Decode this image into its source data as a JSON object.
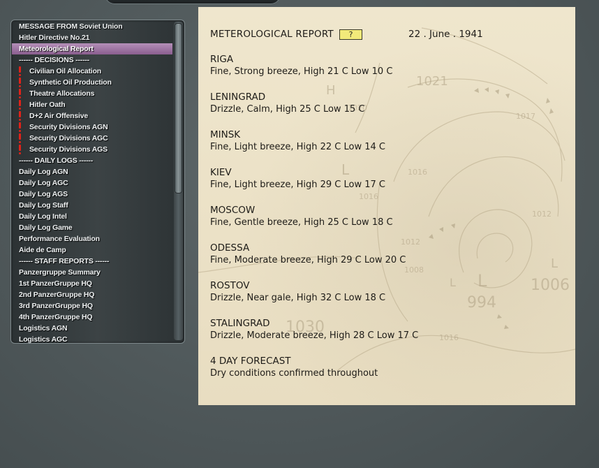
{
  "sidebar": {
    "items": [
      {
        "label": "MESSAGE FROM Soviet Union",
        "type": "message"
      },
      {
        "label": "Hitler Directive No.21",
        "type": "message"
      },
      {
        "label": "Meteorological Report",
        "type": "message",
        "selected": true
      },
      {
        "label": "------ DECISIONS ------",
        "type": "header"
      },
      {
        "label": "Civilian Oil Allocation",
        "type": "decision",
        "alert": true
      },
      {
        "label": "Synthetic Oil Production",
        "type": "decision",
        "alert": true
      },
      {
        "label": "Theatre Allocations",
        "type": "decision",
        "alert": true
      },
      {
        "label": "Hitler Oath",
        "type": "decision",
        "alert": true
      },
      {
        "label": "D+2 Air Offensive",
        "type": "decision",
        "alert": true
      },
      {
        "label": "Security Divisions AGN",
        "type": "decision",
        "alert": true
      },
      {
        "label": "Security Divisions AGC",
        "type": "decision",
        "alert": true
      },
      {
        "label": "Security Divisions AGS",
        "type": "decision",
        "alert": true
      },
      {
        "label": "------ DAILY LOGS ------",
        "type": "header"
      },
      {
        "label": "Daily Log AGN",
        "type": "log"
      },
      {
        "label": "Daily Log AGC",
        "type": "log"
      },
      {
        "label": "Daily Log AGS",
        "type": "log"
      },
      {
        "label": "Daily Log Staff",
        "type": "log"
      },
      {
        "label": "Daily Log Intel",
        "type": "log"
      },
      {
        "label": "Daily Log Game",
        "type": "log"
      },
      {
        "label": "Performance Evaluation",
        "type": "log"
      },
      {
        "label": "Aide de Camp",
        "type": "log"
      },
      {
        "label": "------ STAFF REPORTS ------",
        "type": "header"
      },
      {
        "label": "Panzergruppe Summary",
        "type": "report"
      },
      {
        "label": "1st PanzerGruppe HQ",
        "type": "report"
      },
      {
        "label": "2nd PanzerGruppe HQ",
        "type": "report"
      },
      {
        "label": "3rd PanzerGruppe HQ",
        "type": "report"
      },
      {
        "label": "4th PanzerGruppe HQ",
        "type": "report"
      },
      {
        "label": "Logistics AGN",
        "type": "report"
      },
      {
        "label": "Logistics AGC",
        "type": "report"
      }
    ],
    "alert_color": "#e0231a",
    "selected_color": "#a07aa5"
  },
  "report": {
    "title": "METEROLOGICAL REPORT",
    "help_label": "?",
    "date": "22 . June . 1941",
    "cities": [
      {
        "name": "RIGA",
        "conditions": "Fine, Strong breeze, High 21 C Low 10 C"
      },
      {
        "name": "LENINGRAD",
        "conditions": "Drizzle, Calm, High 25 C Low 15 C"
      },
      {
        "name": "MINSK",
        "conditions": "Fine, Light breeze, High 22 C Low 14 C"
      },
      {
        "name": "KIEV",
        "conditions": "Fine, Light breeze, High 29 C Low 17 C"
      },
      {
        "name": "MOSCOW",
        "conditions": "Fine, Gentle breeze, High 25 C Low 18 C"
      },
      {
        "name": "ODESSA",
        "conditions": "Fine, Moderate breeze, High 29 C Low 20 C"
      },
      {
        "name": "ROSTOV",
        "conditions": "Drizzle, Near gale, High 32 C Low 18 C"
      },
      {
        "name": "STALINGRAD",
        "conditions": "Drizzle, Moderate breeze, High 28 C Low 17 C"
      }
    ],
    "forecast_title": "4 DAY FORECAST",
    "forecast_text": "Dry conditions confirmed throughout",
    "map_labels": [
      "1021",
      "H",
      "L",
      "1016",
      "L",
      "1012",
      "1008",
      "L",
      "994",
      "1030",
      "1016",
      "1006",
      "L",
      "1020",
      "1017",
      "1016",
      "1012"
    ]
  }
}
